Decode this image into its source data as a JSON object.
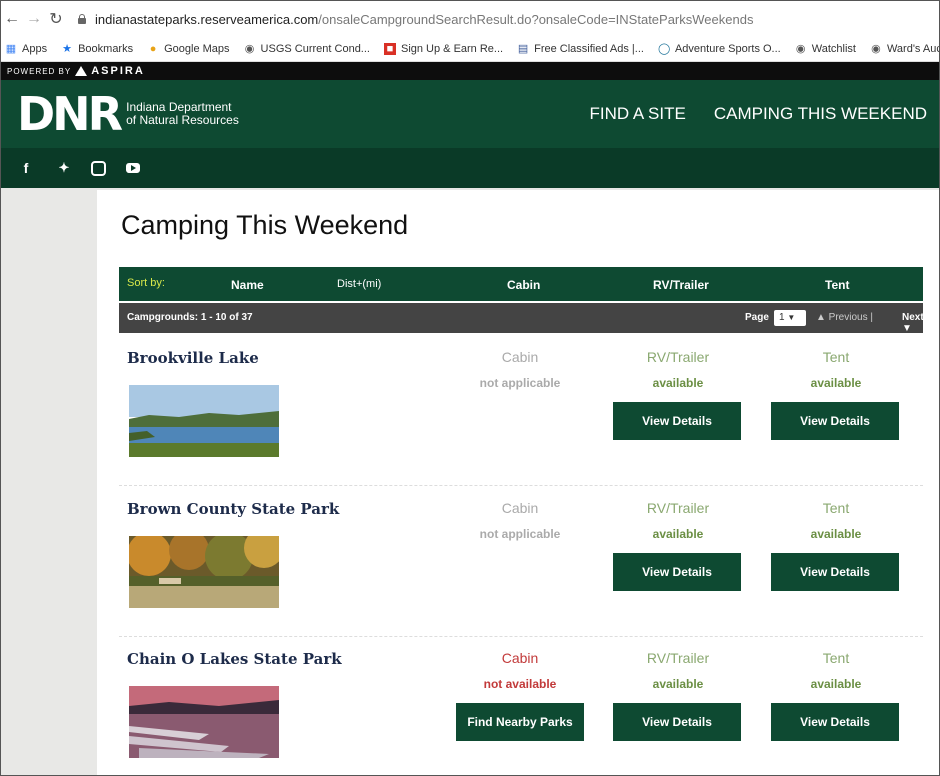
{
  "browser": {
    "url_host": "indianastateparks.reserveamerica.com",
    "url_path": "/onsaleCampgroundSearchResult.do?onsaleCode=INStateParksWeekends",
    "bookmarks": [
      "Apps",
      "Bookmarks",
      "Google Maps",
      "USGS Current Cond...",
      "Sign Up & Earn Re...",
      "Free Classified Ads |...",
      "Adventure Sports O...",
      "Watchlist",
      "Ward's Auctions |..."
    ]
  },
  "aspira": {
    "powered": "POWERED BY",
    "brand": "ASPIRA"
  },
  "header": {
    "logo": "DNR",
    "org_line1": "Indiana Department",
    "org_line2": "of Natural Resources",
    "nav": [
      "FIND A SITE",
      "CAMPING THIS WEEKEND"
    ]
  },
  "social": [
    "facebook-icon",
    "twitter-icon",
    "instagram-icon",
    "youtube-icon"
  ],
  "page_title": "Camping This Weekend",
  "sort_bar": {
    "label": "Sort by:",
    "name": "Name",
    "dist": "Dist+(mi)",
    "cabin": "Cabin",
    "rv": "RV/Trailer",
    "tent": "Tent"
  },
  "count_bar": {
    "label": "Campgrounds: 1 - 10 of 37",
    "page_label": "Page",
    "page_value": "1",
    "previous": "▲ Previous |",
    "next": "Next ▼"
  },
  "parks": [
    {
      "name": "Brookville Lake",
      "cabin": "Cabin",
      "cabin_status": "not applicable",
      "rv": "RV/Trailer",
      "rv_status": "available",
      "rv_button": "View Details",
      "tent": "Tent",
      "tent_status": "available",
      "tent_button": "View Details"
    },
    {
      "name": "Brown County State Park",
      "cabin": "Cabin",
      "cabin_status": "not applicable",
      "rv": "RV/Trailer",
      "rv_status": "available",
      "rv_button": "View Details",
      "tent": "Tent",
      "tent_status": "available",
      "tent_button": "View Details"
    },
    {
      "name": "Chain O Lakes State Park",
      "cabin": "Cabin",
      "cabin_status": "not available",
      "cabin_button": "Find Nearby Parks",
      "rv": "RV/Trailer",
      "rv_status": "available",
      "rv_button": "View Details",
      "tent": "Tent",
      "tent_status": "available",
      "tent_button": "View Details"
    }
  ],
  "colors": {
    "dnr_green": "#0e4a32",
    "dark_green": "#0a3a27",
    "status_red": "#c23a3a",
    "status_green": "#6b8f44"
  }
}
